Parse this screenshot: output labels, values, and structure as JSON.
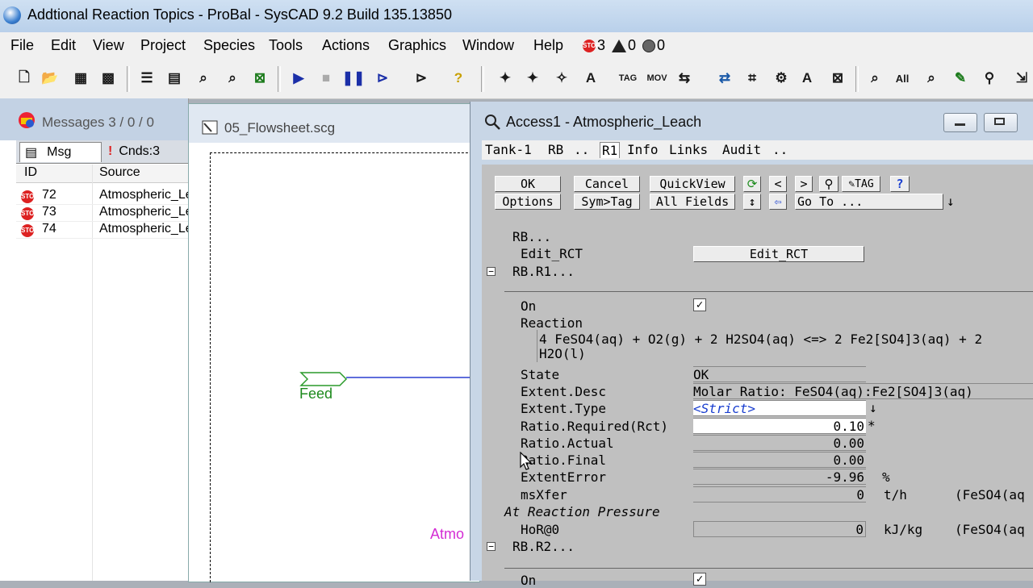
{
  "window": {
    "title": "Addtional Reaction Topics - ProBal - SysCAD 9.2 Build 135.13850"
  },
  "menu": [
    "File",
    "Edit",
    "View",
    "Project",
    "Species",
    "Tools",
    "Actions",
    "Graphics",
    "Window",
    "Help"
  ],
  "status": {
    "errors": "3",
    "warnings": "0",
    "notes": "0"
  },
  "messages": {
    "title": "Messages 3 / 0 / 0",
    "tab_msg": "Msg",
    "tab_cnds": "Cnds:3",
    "col_id": "ID",
    "col_source": "Source",
    "rows": [
      {
        "id": "72",
        "source": "Atmospheric_Leach"
      },
      {
        "id": "73",
        "source": "Atmospheric_Leach"
      },
      {
        "id": "74",
        "source": "Atmospheric_Leach"
      }
    ]
  },
  "flowsheet": {
    "title": "05_Flowsheet.scg",
    "feed_label": "Feed",
    "unit_label": "Atmo"
  },
  "access": {
    "title": "Access1 - Atmospheric_Leach",
    "tabs": [
      "Tank-1",
      "RB",
      "..",
      "R1",
      "Info",
      "Links",
      "Audit",
      ".."
    ],
    "buttons": {
      "ok": "OK",
      "cancel": "Cancel",
      "quickview": "QuickView",
      "lt": "<",
      "gt": ">",
      "tag": "TAG",
      "help": "?",
      "options": "Options",
      "symtag": "Sym>Tag",
      "allfields": "All Fields",
      "goto": "Go To ..."
    },
    "rb_label": "RB...",
    "edit_rct_label": "Edit_RCT",
    "edit_rct_button": "Edit_RCT",
    "rb_r1": "RB.R1...",
    "on_label": "On",
    "reaction_label": "Reaction",
    "reaction_line1": "4 FeSO4(aq) + O2(g) + 2 H2SO4(aq) <=> 2 Fe2[SO4]3(aq) + 2",
    "reaction_line2": "H2O(l)",
    "rows": [
      {
        "label": "State",
        "value": "OK",
        "unit": "",
        "extra": ""
      },
      {
        "label": "Extent.Desc",
        "value": "Molar Ratio: FeSO4(aq):Fe2[SO4]3(aq)",
        "unit": "",
        "extra": ""
      },
      {
        "label": "Extent.Type",
        "value": "<Strict>",
        "unit": "",
        "extra": ""
      },
      {
        "label": "Ratio.Required(Rct)",
        "value": "0.10",
        "unit": "*",
        "extra": ""
      },
      {
        "label": "Ratio.Actual",
        "value": "0.00",
        "unit": "",
        "extra": ""
      },
      {
        "label": "Ratio.Final",
        "value": "0.00",
        "unit": "",
        "extra": ""
      },
      {
        "label": "ExtentError",
        "value": "-9.96",
        "unit": "%",
        "extra": ""
      },
      {
        "label": "msXfer",
        "value": "0",
        "unit": "t/h",
        "extra": "(FeSO4(aq"
      }
    ],
    "pressure_header": "At Reaction Pressure",
    "hor_label": "HoR@0",
    "hor_value": "0",
    "hor_unit": "kJ/kg",
    "hor_extra": "(FeSO4(aq",
    "rb_r2": "RB.R2...",
    "on2_label": "On"
  }
}
